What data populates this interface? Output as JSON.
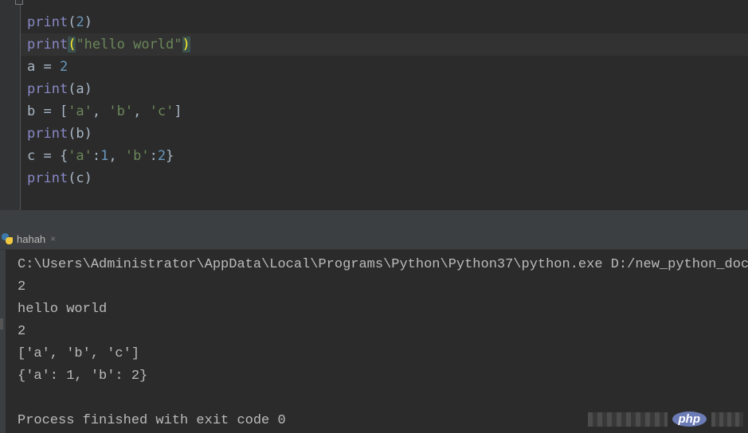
{
  "editor": {
    "lines": [
      [
        {
          "t": "print",
          "c": "fn"
        },
        {
          "t": "(",
          "c": ""
        },
        {
          "t": "2",
          "c": "num"
        },
        {
          "t": ")",
          "c": ""
        }
      ],
      [
        {
          "t": "print",
          "c": "fn"
        },
        {
          "t": "(",
          "c": "paren-hl"
        },
        {
          "t": "\"hello world\"",
          "c": "str"
        },
        {
          "t": ")",
          "c": "paren-hl"
        }
      ],
      [
        {
          "t": "a = ",
          "c": ""
        },
        {
          "t": "2",
          "c": "num"
        }
      ],
      [
        {
          "t": "print",
          "c": "fn"
        },
        {
          "t": "(a)",
          "c": ""
        }
      ],
      [
        {
          "t": "b = [",
          "c": ""
        },
        {
          "t": "'a'",
          "c": "str"
        },
        {
          "t": ", ",
          "c": ""
        },
        {
          "t": "'b'",
          "c": "str"
        },
        {
          "t": ", ",
          "c": ""
        },
        {
          "t": "'c'",
          "c": "str"
        },
        {
          "t": "]",
          "c": ""
        }
      ],
      [
        {
          "t": "print",
          "c": "fn"
        },
        {
          "t": "(b)",
          "c": ""
        }
      ],
      [
        {
          "t": "c = {",
          "c": ""
        },
        {
          "t": "'a'",
          "c": "str"
        },
        {
          "t": ":",
          "c": ""
        },
        {
          "t": "1",
          "c": "num"
        },
        {
          "t": ", ",
          "c": ""
        },
        {
          "t": "'b'",
          "c": "str"
        },
        {
          "t": ":",
          "c": ""
        },
        {
          "t": "2",
          "c": "num"
        },
        {
          "t": "}",
          "c": ""
        }
      ],
      [
        {
          "t": "print",
          "c": "fn"
        },
        {
          "t": "(c)",
          "c": ""
        }
      ]
    ],
    "current_line": 1
  },
  "run_panel": {
    "tab_label": "hahah",
    "tab_close": "×",
    "icon": "python-icon"
  },
  "console": {
    "lines": [
      "C:\\Users\\Administrator\\AppData\\Local\\Programs\\Python\\Python37\\python.exe D:/new_python_docum",
      "2",
      "hello world",
      "2",
      "['a', 'b', 'c']",
      "{'a': 1, 'b': 2}",
      "",
      "Process finished with exit code 0"
    ]
  },
  "watermark": {
    "logo_text": "php"
  },
  "colors": {
    "background": "#2b2b2b",
    "keyword_builtin": "#8888c6",
    "number": "#6897bb",
    "string": "#6a8759",
    "text": "#a9b7c6",
    "console_text": "#bbbbbb"
  }
}
